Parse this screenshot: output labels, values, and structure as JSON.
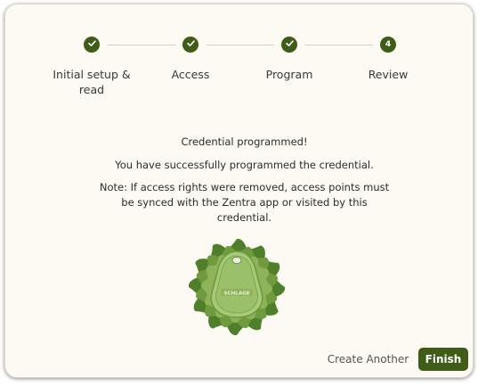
{
  "stepper": {
    "steps": [
      {
        "label": "Initial setup & read",
        "state": "complete",
        "icon": "check-icon"
      },
      {
        "label": "Access",
        "state": "complete",
        "icon": "check-icon"
      },
      {
        "label": "Program",
        "state": "complete",
        "icon": "check-icon"
      },
      {
        "label": "Review",
        "state": "current",
        "number": "4"
      }
    ]
  },
  "content": {
    "title": "Credential programmed!",
    "subtitle": "You have successfully programmed the credential.",
    "note": "Note: If access rights were removed, access points must be synced with the Zentra app or visited by this credential.",
    "fob_brand_text": "SCHLAGE"
  },
  "actions": {
    "create_another_label": "Create Another",
    "finish_label": "Finish"
  },
  "colors": {
    "accent": "#3f5d18",
    "badge_outer": "#4f7f2a",
    "badge_mid": "#6f9a3d",
    "badge_inner": "#8fb35a",
    "fob": "#9bc06a",
    "background": "#fcfaf3"
  }
}
